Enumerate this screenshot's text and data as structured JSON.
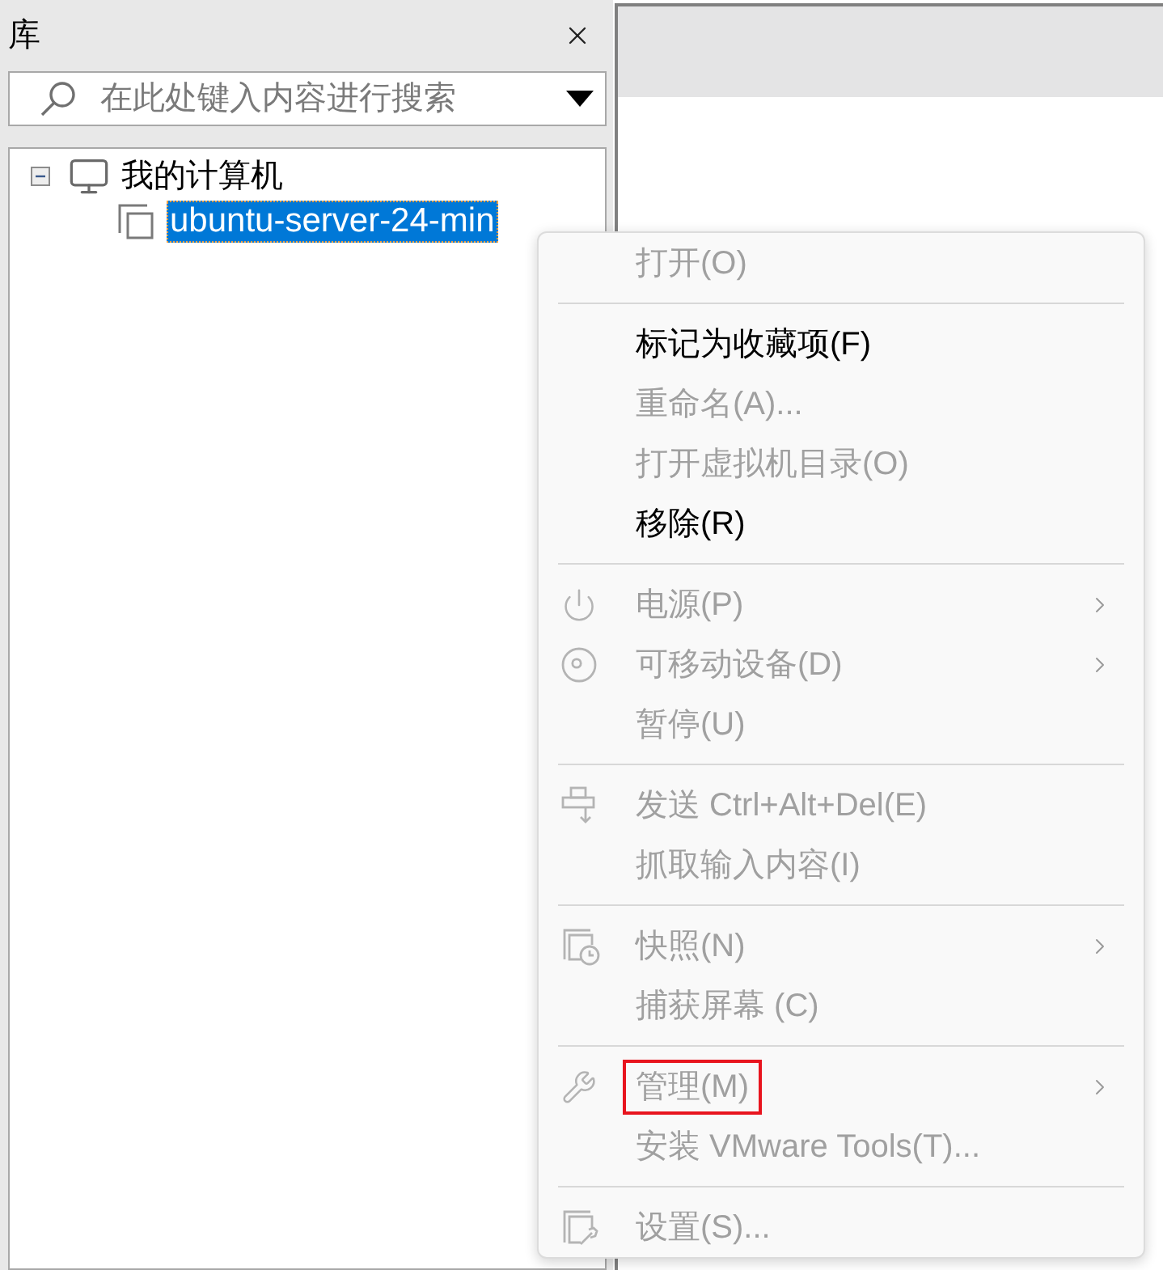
{
  "library": {
    "title": "库",
    "search": {
      "placeholder": "在此处键入内容进行搜索"
    },
    "tree": [
      {
        "label": "我的计算机",
        "expanded": true,
        "selected": false,
        "children": [
          {
            "label": "ubuntu-server-24-min",
            "selected": true
          }
        ]
      }
    ]
  },
  "context_menu": {
    "groups": [
      [
        {
          "kind": "text",
          "label": "打开(O)",
          "disabled": true,
          "submenu": false,
          "highlighted": false
        }
      ],
      [
        {
          "kind": "text",
          "label": "标记为收藏项(F)",
          "disabled": false,
          "submenu": false,
          "highlighted": false
        },
        {
          "kind": "text",
          "label": "重命名(A)...",
          "disabled": true,
          "submenu": false,
          "highlighted": false
        },
        {
          "kind": "text",
          "label": "打开虚拟机目录(O)",
          "disabled": true,
          "submenu": false,
          "highlighted": false
        },
        {
          "kind": "text",
          "label": "移除(R)",
          "disabled": false,
          "submenu": false,
          "highlighted": false
        }
      ],
      [
        {
          "kind": "power",
          "label": "电源(P)",
          "disabled": true,
          "submenu": true,
          "highlighted": false
        },
        {
          "kind": "removable-devices",
          "label": "可移动设备(D)",
          "disabled": true,
          "submenu": true,
          "highlighted": false
        },
        {
          "kind": "text",
          "label": "暂停(U)",
          "disabled": true,
          "submenu": false,
          "highlighted": false
        }
      ],
      [
        {
          "kind": "send-keys",
          "label": "发送 Ctrl+Alt+Del(E)",
          "disabled": true,
          "submenu": false,
          "highlighted": false
        },
        {
          "kind": "text",
          "label": "抓取输入内容(I)",
          "disabled": true,
          "submenu": false,
          "highlighted": false
        }
      ],
      [
        {
          "kind": "snapshot",
          "label": "快照(N)",
          "disabled": true,
          "submenu": true,
          "highlighted": false
        },
        {
          "kind": "text",
          "label": "捕获屏幕 (C)",
          "disabled": true,
          "submenu": false,
          "highlighted": false
        }
      ],
      [
        {
          "kind": "manage",
          "label": "管理(M)",
          "disabled": true,
          "submenu": true,
          "highlighted": true
        },
        {
          "kind": "text",
          "label": "安装 VMware Tools(T)...",
          "disabled": true,
          "submenu": false,
          "highlighted": false
        }
      ],
      [
        {
          "kind": "settings",
          "label": "设置(S)...",
          "disabled": true,
          "submenu": false,
          "highlighted": false
        }
      ]
    ]
  }
}
